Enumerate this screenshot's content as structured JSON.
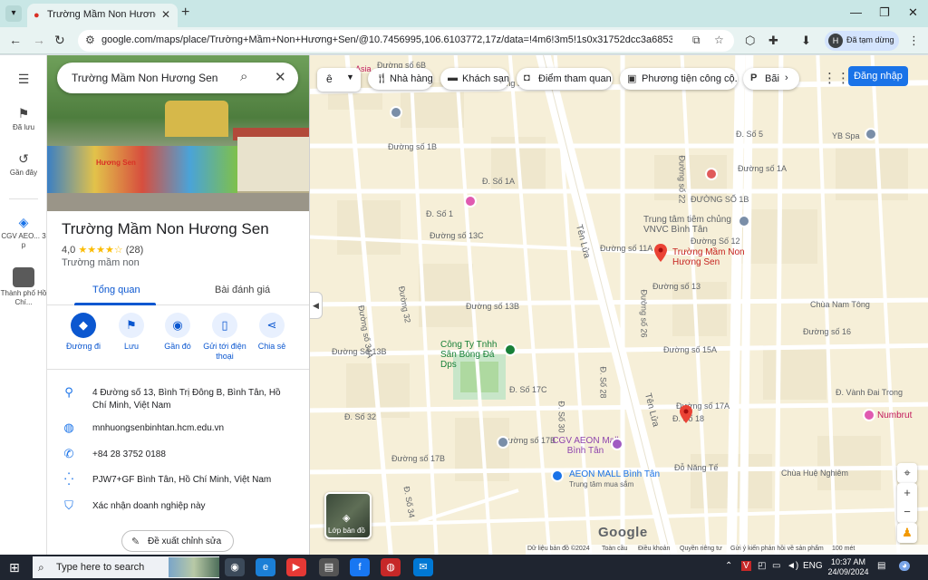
{
  "browser": {
    "tab_title": "Trường Mầm Non Hương Sen -",
    "url": "google.com/maps/place/Trường+Mầm+Non+Hương+Sen/@10.7456995,106.6103772,17z/data=!4m6!3m5!1s0x31752dcc3a68538d:0xc024d627f...",
    "profile_initial": "H",
    "profile_label": "Đã tạm dừng"
  },
  "rail": {
    "items": [
      {
        "label": "Đã lưu"
      },
      {
        "label": "Gần đây"
      },
      {
        "label": "CGV AEO... 3 p"
      },
      {
        "label": "Thành phố Hồ Chí..."
      }
    ]
  },
  "panel": {
    "search_value": "Trường Mầm Non Hương Sen",
    "photo_sign": "Hương Sen",
    "name": "Trường Mầm Non Hương Sen",
    "rating_value": "4,0",
    "stars": "★★★★☆",
    "review_count": "(28)",
    "category": "Trường mầm non",
    "tabs": {
      "overview": "Tổng quan",
      "reviews": "Bài đánh giá"
    },
    "actions": [
      {
        "label": "Đường đi"
      },
      {
        "label": "Lưu"
      },
      {
        "label": "Gần đó"
      },
      {
        "label": "Gửi tới điện thoại"
      },
      {
        "label": "Chia sẻ"
      }
    ],
    "address": "4 Đường số 13, Bình Trị Đông B, Bình Tân, Hồ Chí Minh, Việt Nam",
    "website": "mnhuongsenbinhtan.hcm.edu.vn",
    "phone": "+84 28 3752 0188",
    "plus_code": "PJW7+GF Bình Tân, Hồ Chí Minh, Việt Nam",
    "claim": "Xác nhận doanh nghiệp này",
    "suggest_edit": "Đề xuất chỉnh sửa"
  },
  "map": {
    "chips": [
      {
        "icon": "fork-knife-icon",
        "label": "Nhà hàng"
      },
      {
        "icon": "bed-icon",
        "label": "Khách sạn"
      },
      {
        "icon": "camera-icon",
        "label": "Điểm tham quan"
      },
      {
        "icon": "bus-icon",
        "label": "Phương tiện công cộ..."
      },
      {
        "icon": "parking-icon",
        "label": "Bãi"
      }
    ],
    "sign_in": "Đăng nhập",
    "place_label": "Trường Mầm Non Hương Sen",
    "labels": {
      "asia": "Asia",
      "d_so_6b": "Đường số 6B",
      "d_so_6a": "Đường số 6A",
      "d_so_5": "Đ. Số 5",
      "yb_spa": "YB Spa",
      "d_so_1a": "Đường số 1A",
      "d_so_1b_a": "Đường số 1B",
      "d_so_1b_b": "ĐƯỜNG SỐ 1B",
      "vaccine": "Trung tâm tiêm chủng VNVC Bình Tân",
      "d_so_13c": "Đường số 13C",
      "d_so_13b": "Đường số 13B",
      "d_so_13b_b": "Đường Số 13B",
      "d_so_13": "Đường số 13",
      "d_so_15a": "Đường số 15A",
      "chua_nam_tong": "Chùa Nam Tông",
      "football": "Công Ty Tnhh Sân Bóng Đá Dps",
      "d_so_17c": "Đ. Số 17C",
      "d_so_17a": "Đường số 17A",
      "d_so_17b": "Đường số 17B",
      "d_so_17b_b": "Đường số 17B",
      "numbrut": "Numbrut",
      "cgv": "CGV AEON Mall Bình Tân",
      "aeon": "AEON MALL Bình Tân",
      "aeon_sub": "Trung tâm mua sắm",
      "d_nang_te": "Đỗ Năng Tế",
      "chua_hue_nghiem": "Chùa Huệ Nghiêm",
      "ten_lua": "Tên Lửa",
      "ten_lua_2": "Tên Lửa",
      "d_so_28": "Đ. Số 28",
      "d_so_26": "Đường số 26",
      "d_so_22": "Đường số 22",
      "d_so_30": "Đ. Số 30",
      "d_so_32": "Đường 32",
      "d_so_34a": "Đường số 34A",
      "d_so_34": "Đ. Số 34",
      "vanh_dai_trong": "Đ. Vành Đai Trong",
      "d_so_16": "Đường số 16",
      "d_so_18": "Đ. Số 18",
      "d_so_1": "Đ. Số 1",
      "d_so_1a_b": "Đ. Số 1A",
      "d_so_11a": "Đường số 11A",
      "d_so_12": "Đường Số 12",
      "d_so_32b": "Đ. Số 32"
    },
    "layers_label": "Lớp bản đồ",
    "google": "Google",
    "footer": {
      "data": "Dữ liệu bản đồ ©2024",
      "global": "Toàn cầu",
      "terms": "Điều khoản",
      "privacy": "Quyền riêng tư",
      "feedback": "Gửi ý kiến phản hồi về sản phẩm",
      "scale": "100 mét"
    }
  },
  "taskbar": {
    "search_placeholder": "Type here to search",
    "lang": "ENG",
    "time": "10:37 AM",
    "date": "24/09/2024"
  }
}
